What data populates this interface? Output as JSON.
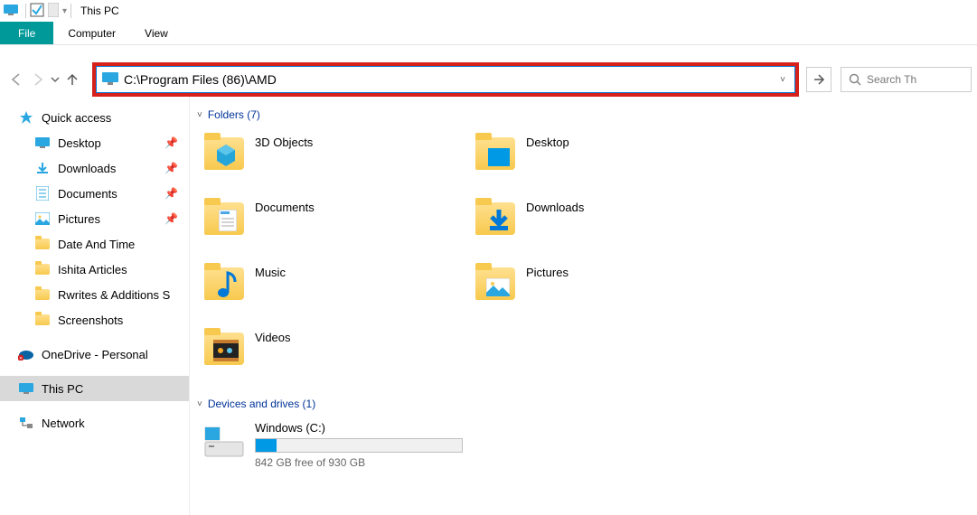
{
  "titlebar": {
    "title": "This PC"
  },
  "ribbon": {
    "file": "File",
    "computer": "Computer",
    "view": "View"
  },
  "nav": {
    "address_value": "C:\\Program Files (86)\\AMD",
    "search_placeholder": "Search Th"
  },
  "sidebar": {
    "quick_access": "Quick access",
    "items": [
      {
        "label": "Desktop",
        "pin": true
      },
      {
        "label": "Downloads",
        "pin": true
      },
      {
        "label": "Documents",
        "pin": true
      },
      {
        "label": "Pictures",
        "pin": true
      },
      {
        "label": "Date And Time",
        "pin": false
      },
      {
        "label": "Ishita Articles",
        "pin": false
      },
      {
        "label": "Rwrites & Additions S",
        "pin": false
      },
      {
        "label": "Screenshots",
        "pin": false
      }
    ],
    "onedrive": "OneDrive - Personal",
    "thispc": "This PC",
    "network": "Network"
  },
  "content": {
    "folders_header": "Folders (7)",
    "folders": [
      "3D Objects",
      "Desktop",
      "Documents",
      "Downloads",
      "Music",
      "Pictures",
      "Videos"
    ],
    "drives_header": "Devices and drives (1)",
    "drive": {
      "name": "Windows (C:)",
      "free_text": "842 GB free of 930 GB",
      "fill_percent": 10
    }
  }
}
